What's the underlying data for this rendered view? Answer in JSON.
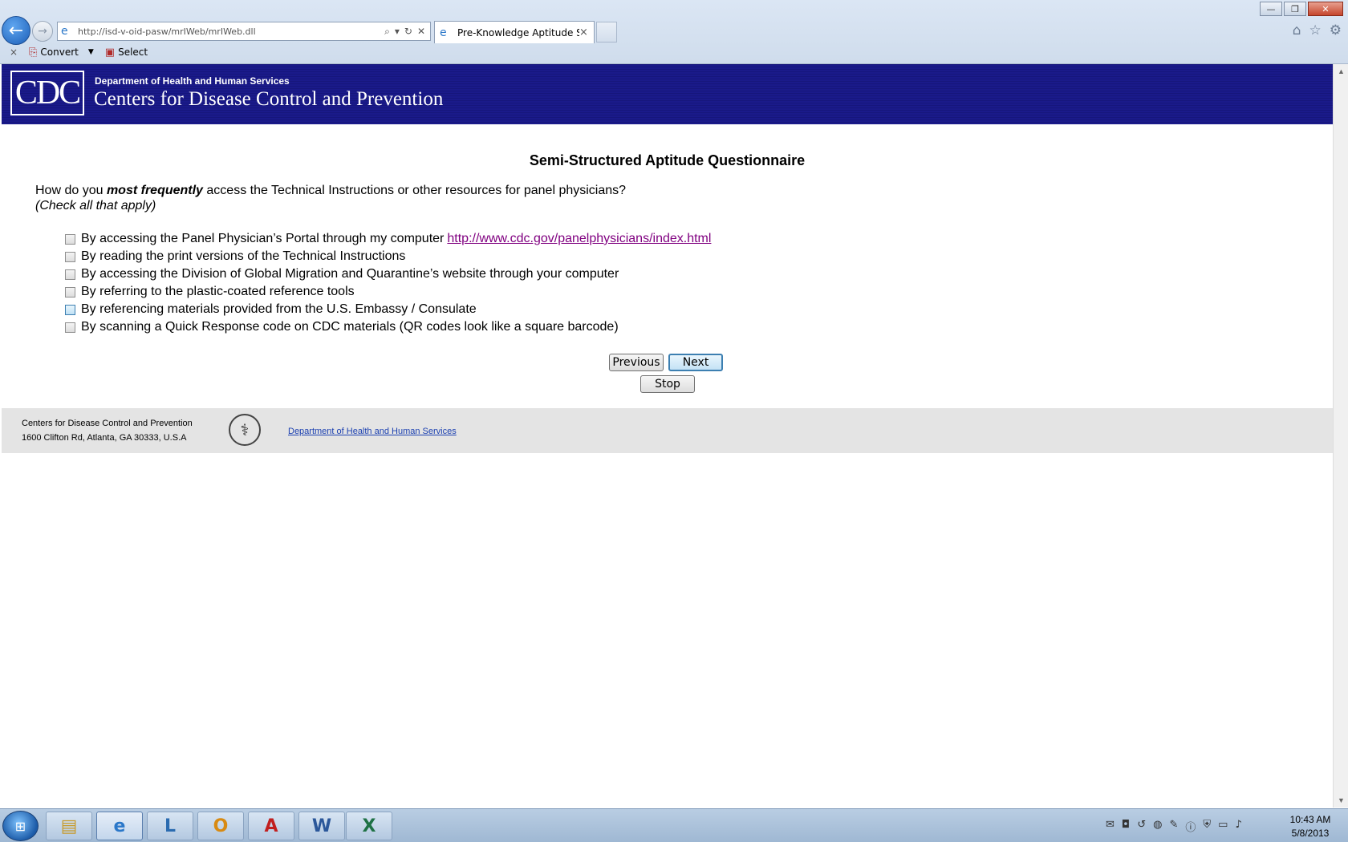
{
  "browser": {
    "url": "http://isd-v-oid-pasw/mrIWeb/mrIWeb.dll",
    "tab_title": "Pre-Knowledge Aptitude S...",
    "tab_close": "×",
    "command_bar": {
      "close": "×",
      "convert_label": "Convert",
      "select_label": "Select"
    }
  },
  "header": {
    "logo_text": "CDC",
    "department": "Department of Health and Human Services",
    "agency": "Centers for Disease Control and Prevention"
  },
  "survey": {
    "title": "Semi-Structured Aptitude Questionnaire",
    "question_prefix": "How do you ",
    "question_emphasis": "most frequently",
    "question_suffix": " access the Technical Instructions or other resources for panel physicians?",
    "hint": "(Check all that apply)",
    "options": [
      {
        "label": "By accessing the Panel Physician’s Portal through my computer",
        "link": "http://www.cdc.gov/panelphysicians/index.html",
        "checked": false
      },
      {
        "label": "By reading the print versions of the Technical Instructions",
        "checked": false
      },
      {
        "label": "By accessing the Division of Global Migration and Quarantine’s website through your computer",
        "checked": false
      },
      {
        "label": "By referring to the plastic-coated reference tools",
        "checked": false
      },
      {
        "label": "By referencing materials provided from the U.S. Embassy / Consulate",
        "checked": false
      },
      {
        "label": "By scanning a Quick Response code on CDC materials (QR codes look like a square barcode)",
        "checked": false
      }
    ],
    "buttons": {
      "previous": "Previous",
      "next": "Next",
      "stop": "Stop"
    }
  },
  "footer": {
    "org": "Centers for Disease Control and Prevention",
    "address": "1600 Clifton Rd, Atlanta, GA 30333, U.S.A",
    "hhs_link": "Department of Health and Human Services"
  },
  "taskbar": {
    "apps": [
      "file-explorer-icon",
      "internet-explorer-icon",
      "lync-icon",
      "outlook-icon",
      "acrobat-icon",
      "word-icon",
      "excel-icon"
    ],
    "time": "10:43 AM",
    "date": "5/8/2013"
  }
}
